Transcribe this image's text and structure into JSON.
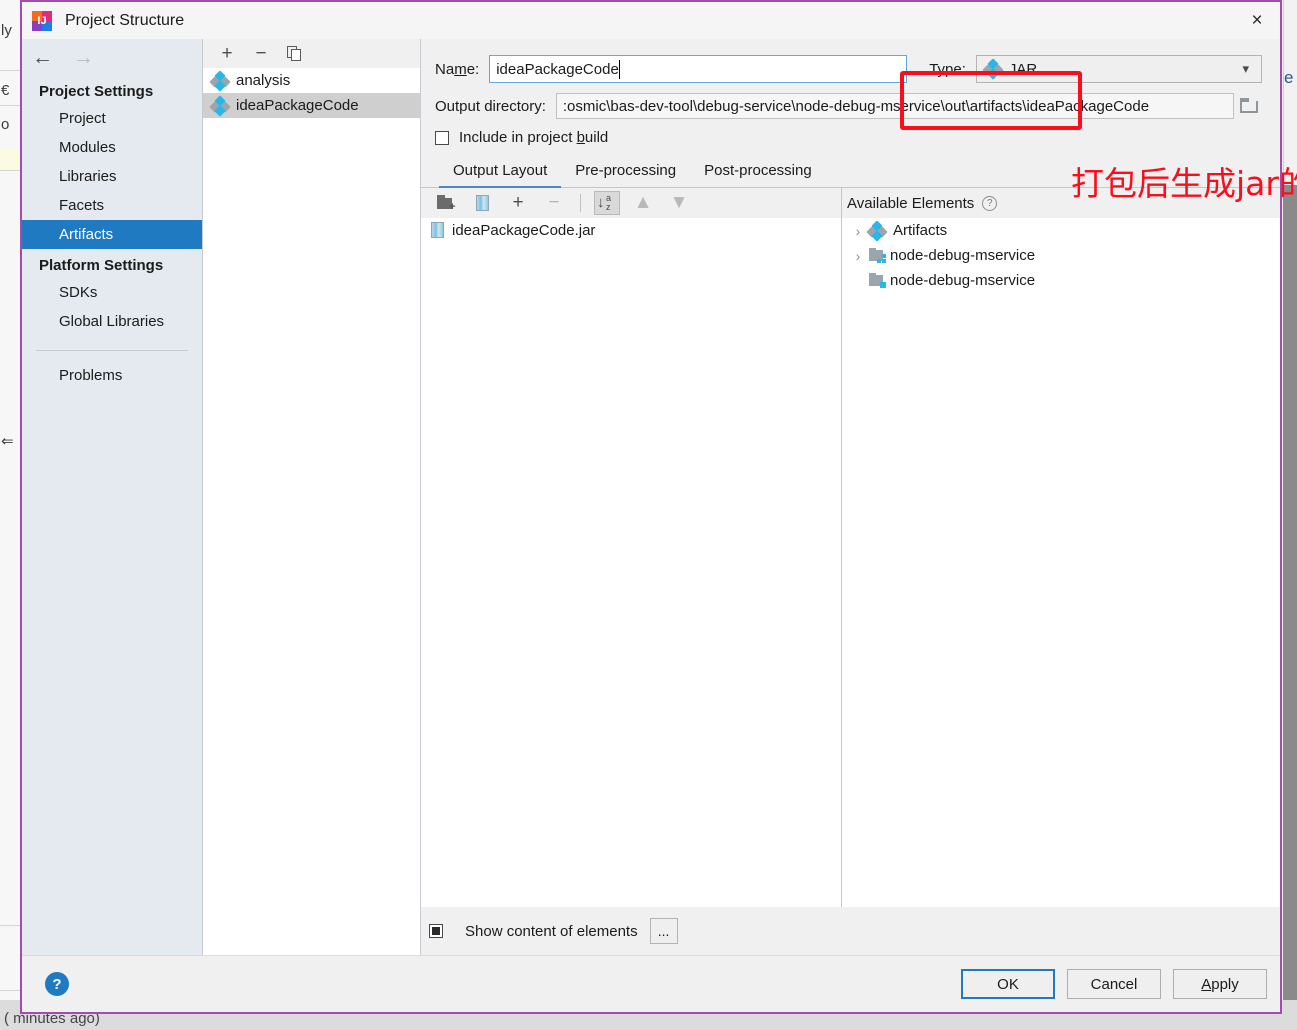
{
  "window": {
    "title": "Project Structure",
    "app_icon": "intellij-idea-icon",
    "close_label": "×"
  },
  "background": {
    "left_glyphs": [
      "ly",
      "€",
      "o",
      "⇐"
    ],
    "right_glyph": "e",
    "bottom_text": "( minutes ago)"
  },
  "nav": {
    "back_arrow": "←",
    "forward_arrow": "→",
    "groups": [
      {
        "title": "Project Settings",
        "items": [
          {
            "label": "Project",
            "selected": false
          },
          {
            "label": "Modules",
            "selected": false
          },
          {
            "label": "Libraries",
            "selected": false
          },
          {
            "label": "Facets",
            "selected": false
          },
          {
            "label": "Artifacts",
            "selected": true
          }
        ]
      },
      {
        "title": "Platform Settings",
        "items": [
          {
            "label": "SDKs",
            "selected": false
          },
          {
            "label": "Global Libraries",
            "selected": false
          }
        ]
      }
    ],
    "extra_items": [
      {
        "label": "Problems",
        "selected": false
      }
    ]
  },
  "artifacts_panel": {
    "toolbar": {
      "add": "+",
      "remove": "−",
      "copy": "copy-icon"
    },
    "items": [
      {
        "label": "analysis",
        "selected": false
      },
      {
        "label": "ideaPackageCode",
        "selected": true
      }
    ]
  },
  "form": {
    "name_label_pre": "Na",
    "name_label_mnemonic": "m",
    "name_label_post": "e:",
    "name_value": "ideaPackageCode",
    "type_label": "Type:",
    "type_value": "JAR",
    "type_chevron": "⌄",
    "output_label": "Output directory:",
    "output_value": ":osmic\\bas-dev-tool\\debug-service\\node-debug-mservice\\out\\artifacts\\ideaPackageCode",
    "include_label_pre": "Include in project ",
    "include_label_mnemonic": "b",
    "include_label_post": "uild",
    "include_checked": false
  },
  "tabs": [
    {
      "label": "Output Layout",
      "active": true
    },
    {
      "label": "Pre-processing",
      "active": false
    },
    {
      "label": "Post-processing",
      "active": false
    }
  ],
  "layout_toolbar": {
    "create_directory": "folder-add-icon",
    "create_archive": "jar-add-icon",
    "add_copy": "+",
    "remove": "−",
    "sort_alphabetically": "sort-az-icon",
    "move_up": "▲",
    "move_down": "▼"
  },
  "output_tree": [
    {
      "label": "ideaPackageCode.jar",
      "icon": "jar-icon"
    }
  ],
  "available": {
    "header": "Available Elements",
    "help": "?",
    "items": [
      {
        "label": "Artifacts",
        "icon": "artifact-diamond-icon",
        "expandable": true,
        "expander": "›"
      },
      {
        "label": "node-debug-mservice",
        "icon": "module-production-icon",
        "expandable": true,
        "expander": "›"
      },
      {
        "label": "node-debug-mservice",
        "icon": "module-test-icon",
        "expandable": false,
        "expander": "›"
      }
    ]
  },
  "bottom_bar": {
    "show_content_label": "Show content of elements",
    "show_content_checked": true,
    "more_button": "..."
  },
  "footer": {
    "help": "?",
    "ok": "OK",
    "cancel": "Cancel",
    "apply_pre": "",
    "apply_mnemonic": "A",
    "apply_post": "pply"
  },
  "annotations": {
    "name_box": "red-rectangle-highlight",
    "path_note": "打包后生成jar的路径"
  },
  "colors": {
    "accent_blue": "#1f7ac1",
    "selection_gray": "#cfcfcf",
    "annotation_red": "#fc0d1b",
    "dialog_border_purple": "#a44bb0",
    "nav_bg": "#e4eaf0"
  }
}
